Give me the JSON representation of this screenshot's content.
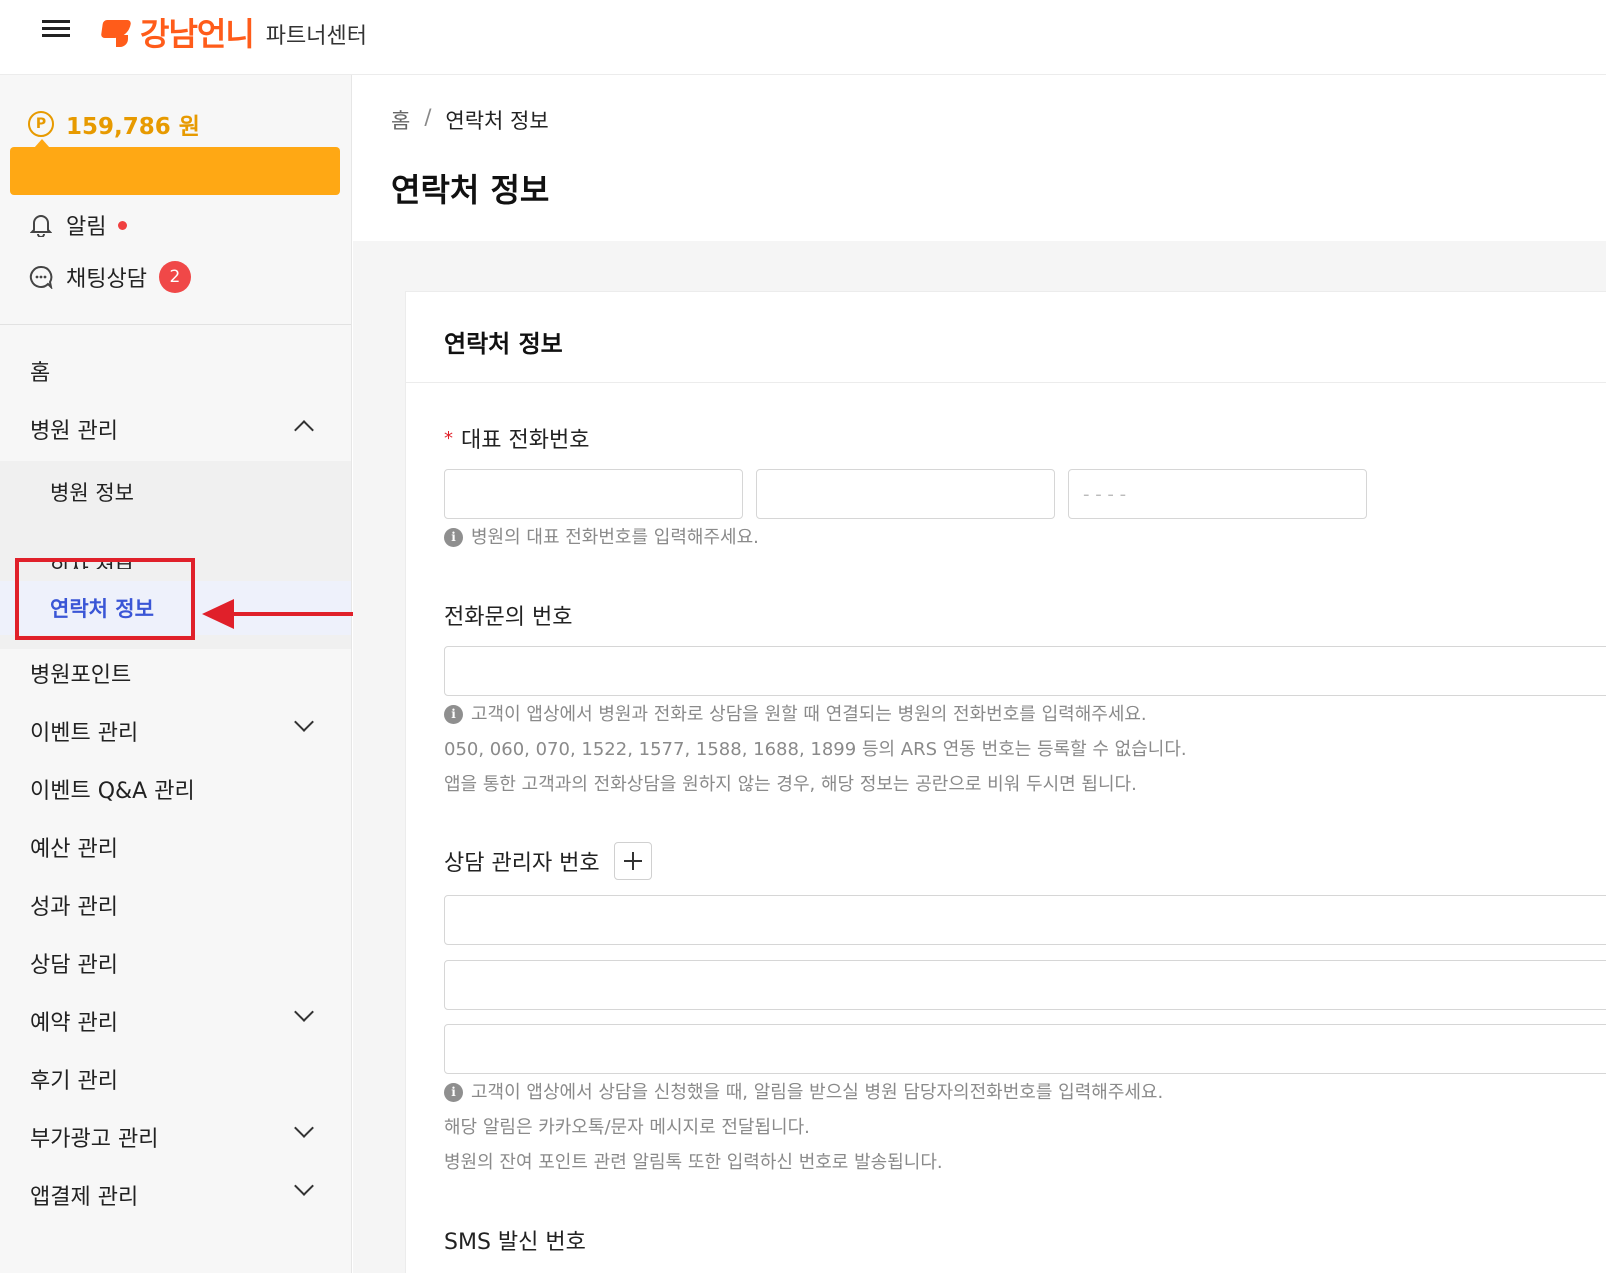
{
  "header": {
    "logo_text": "강남언니",
    "logo_sub": "파트너센터"
  },
  "sidebar": {
    "point_icon": "P",
    "points": "159,786 원",
    "alert_label": "알림",
    "chat_label": "채팅상담",
    "chat_badge": "2",
    "nav": {
      "home": "홈",
      "hospital_mgmt": "병원 관리",
      "sub": {
        "hospital_info": "병원 정보",
        "doctor_info": "의사 정보",
        "contact_info": "연락처 정보"
      },
      "hospital_points": "병원포인트",
      "event_mgmt": "이벤트 관리",
      "event_qa": "이벤트 Q&A 관리",
      "budget": "예산 관리",
      "performance": "성과 관리",
      "consult": "상담 관리",
      "reservation": "예약 관리",
      "review": "후기 관리",
      "ads": "부가광고 관리",
      "app_payment": "앱결제 관리"
    }
  },
  "main": {
    "breadcrumb": {
      "home": "홈",
      "sep": "/",
      "current": "연락처 정보"
    },
    "title": "연락처 정보",
    "card": {
      "title": "연락처 정보",
      "rep_phone": {
        "label": "대표 전화번호",
        "required_mark": "*",
        "field3_placeholder": "- - - -",
        "help": "병원의 대표 전화번호를 입력해주세요."
      },
      "inquiry_phone": {
        "label": "전화문의 번호",
        "help": [
          "고객이 앱상에서 병원과 전화로 상담을 원할 때 연결되는 병원의 전화번호를 입력해주세요.",
          "050, 060, 070, 1522, 1577, 1588, 1688, 1899 등의 ARS 연동 번호는 등록할 수 없습니다.",
          "앱을 통한 고객과의 전화상담을 원하지 않는 경우, 해당 정보는 공란으로 비워 두시면 됩니다."
        ]
      },
      "manager_phone": {
        "label": "상담 관리자 번호",
        "help": [
          "고객이 앱상에서 상담을 신청했을 때, 알림을 받으실 병원 담당자의전화번호를 입력해주세요.",
          "해당 알림은 카카오톡/문자 메시지로 전달됩니다.",
          "병원의 잔여 포인트 관련 알림톡 또한 입력하신 번호로 발송됩니다."
        ]
      },
      "sms": {
        "label": "SMS 발신 번호"
      }
    }
  },
  "colors": {
    "brand": "#ff5c1a",
    "points": "#e79a00",
    "active_nav": "#3a56d6",
    "annotation": "#e0202a"
  }
}
